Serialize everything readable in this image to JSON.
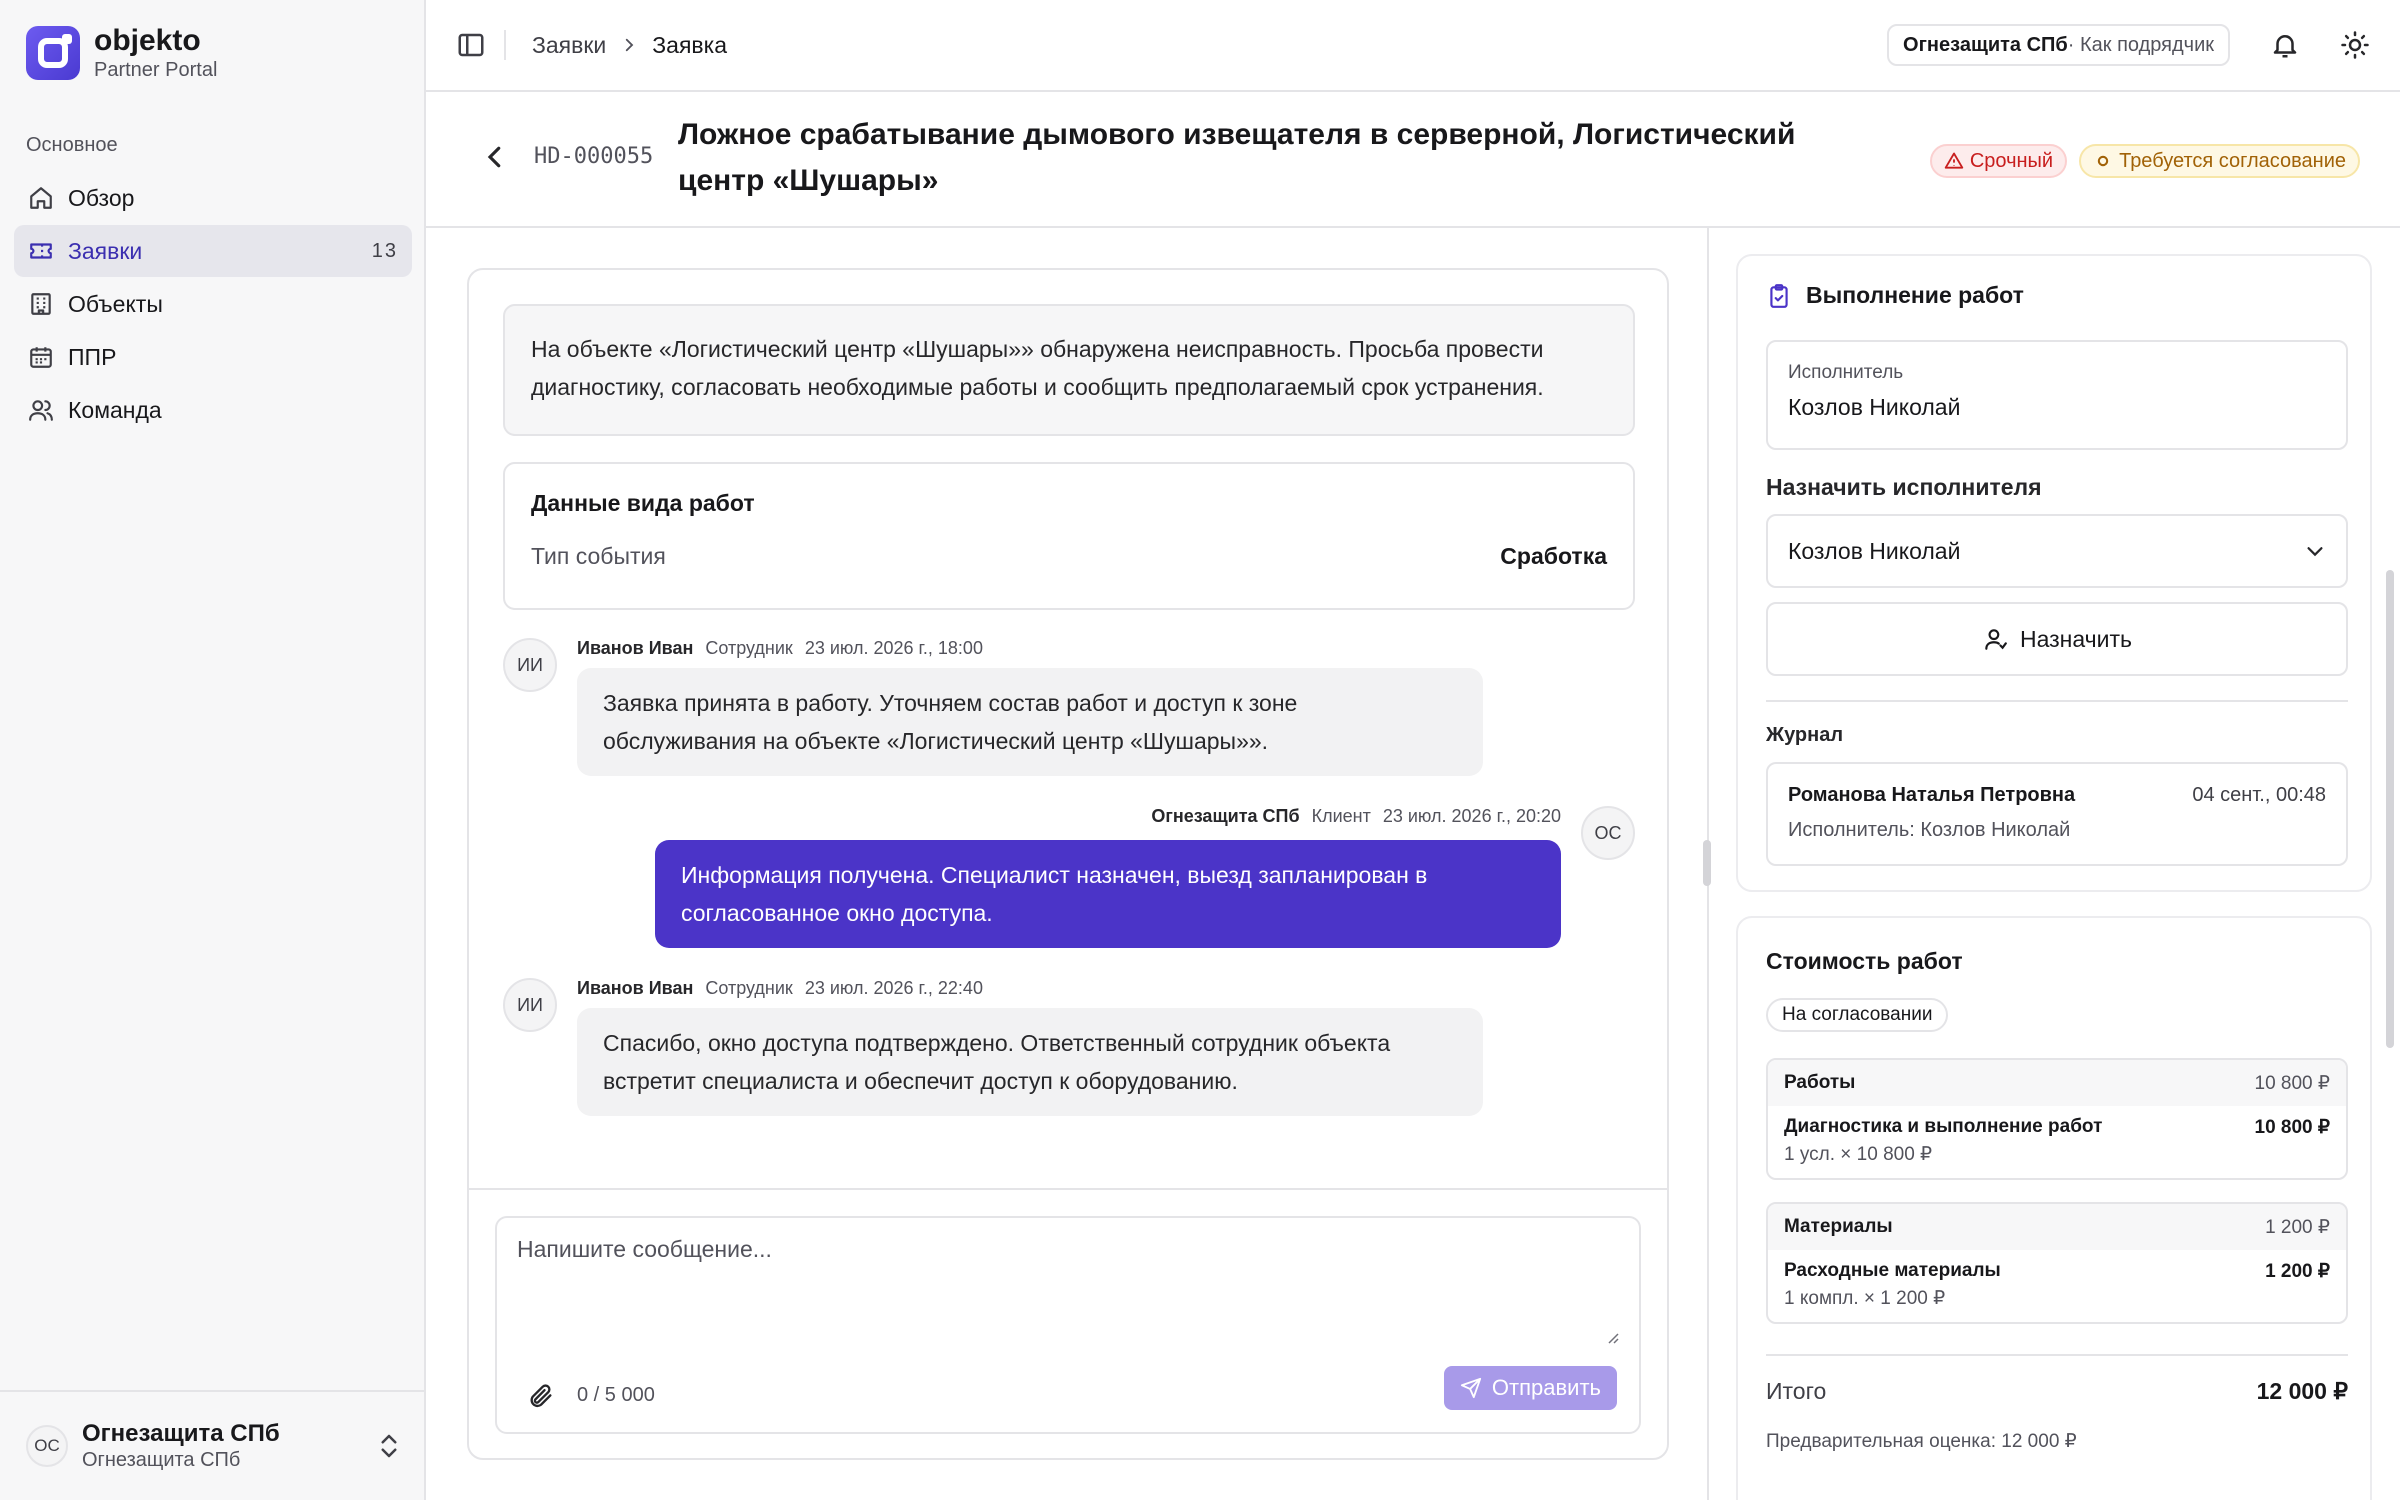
{
  "brand": {
    "name": "objekto",
    "subtitle": "Partner Portal"
  },
  "sidebar": {
    "section_label": "Основное",
    "items": [
      {
        "label": "Обзор",
        "icon": "home-icon",
        "active": false
      },
      {
        "label": "Заявки",
        "icon": "ticket-icon",
        "active": true,
        "badge": "13"
      },
      {
        "label": "Объекты",
        "icon": "building-icon",
        "active": false
      },
      {
        "label": "ППР",
        "icon": "calendar-icon",
        "active": false
      },
      {
        "label": "Команда",
        "icon": "users-icon",
        "active": false
      }
    ],
    "footer": {
      "initials": "ОС",
      "org_name": "Огнезащита СПб",
      "org_sub": "Огнезащита СПб"
    }
  },
  "topbar": {
    "breadcrumbs": [
      "Заявки",
      "Заявка"
    ],
    "context": {
      "org": "Огнезащита СПб",
      "role": " · Как подрядчик"
    }
  },
  "ticket": {
    "id": "HD-000055",
    "title": "Ложное срабатывание дымового извещателя в серверной, Логистический центр «Шушары»",
    "tags": {
      "urgent": "Срочный",
      "approval": "Требуется согласование"
    },
    "description": "На объекте «Логистический центр «Шушары»» обнаружена неисправность. Просьба провести диагностику, согласовать необходимые работы и сообщить предполагаемый срок устранения.",
    "work": {
      "title": "Данные вида работ",
      "key": "Тип события",
      "value": "Сработка"
    }
  },
  "messages": [
    {
      "initials": "ИИ",
      "author": "Иванов Иван",
      "role": "Сотрудник",
      "time": "23 июл. 2026 г., 18:00",
      "direction": "in",
      "text": "Заявка принята в работу. Уточняем состав работ и доступ к зоне обслуживания на объекте «Логистический центр «Шушары»»."
    },
    {
      "initials": "ОС",
      "author": "Огнезащита СПб",
      "role": "Клиент",
      "time": "23 июл. 2026 г., 20:20",
      "direction": "out",
      "text": "Информация получена. Специалист назначен, выезд запланирован в согласованное окно доступа."
    },
    {
      "initials": "ИИ",
      "author": "Иванов Иван",
      "role": "Сотрудник",
      "time": "23 июл. 2026 г., 22:40",
      "direction": "in",
      "text": "Спасибо, окно доступа подтверждено. Ответственный сотрудник объекта встретит специалиста и обеспечит доступ к оборудованию."
    }
  ],
  "composer": {
    "placeholder": "Напишите сообщение...",
    "value": "",
    "counter": "0 / 5 000",
    "send_label": "Отправить"
  },
  "execution": {
    "title": "Выполнение работ",
    "executor_label": "Исполнитель",
    "executor_value": "Козлов Николай",
    "assign_label": "Назначить исполнителя",
    "assign_selected": "Козлов Николай",
    "assign_button": "Назначить",
    "journal_title": "Журнал",
    "journal": [
      {
        "who": "Романова Наталья Петровна",
        "when": "04 сент., 00:48",
        "detail": "Исполнитель: Козлов Николай"
      }
    ]
  },
  "cost": {
    "title": "Стоимость работ",
    "status": "На согласовании",
    "groups": [
      {
        "name": "Работы",
        "sum": "10 800 ₽",
        "line": {
          "name": "Диагностика и выполнение работ",
          "sum": "10 800 ₽",
          "qty": "1 усл. × 10 800 ₽"
        }
      },
      {
        "name": "Материалы",
        "sum": "1 200 ₽",
        "line": {
          "name": "Расходные материалы",
          "sum": "1 200 ₽",
          "qty": "1 компл. × 1 200 ₽"
        }
      }
    ],
    "total_label": "Итого",
    "total_value": "12 000 ₽",
    "estimate": "Предварительная оценка: 12 000 ₽"
  },
  "colors": {
    "accent": "#4b34c8",
    "urgent": "#c81e1e",
    "approval": "#a16207",
    "send_disabled": "#a89ae9"
  }
}
